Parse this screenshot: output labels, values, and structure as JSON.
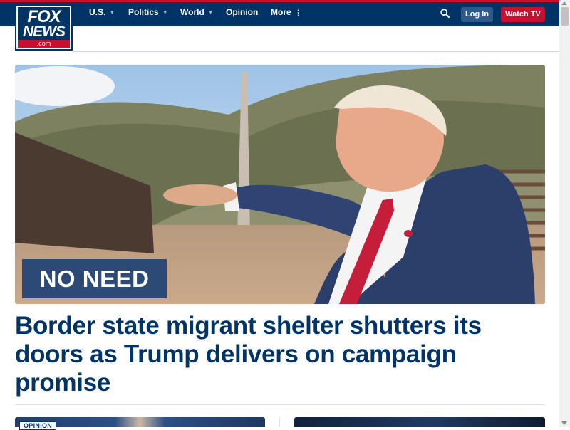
{
  "header": {
    "logo": {
      "line1": "FOX",
      "line2": "NEWS",
      "suffix": ".com"
    },
    "nav": [
      {
        "label": "U.S.",
        "has_dropdown": true
      },
      {
        "label": "Politics",
        "has_dropdown": true
      },
      {
        "label": "World",
        "has_dropdown": true
      },
      {
        "label": "Opinion",
        "has_dropdown": false
      },
      {
        "label": "More",
        "has_dropdown": true
      }
    ],
    "search_icon": "search-icon",
    "login_label": "Log In",
    "watch_label": "Watch TV"
  },
  "hero": {
    "kicker": "NO NEED",
    "headline": "Border state migrant shelter shutters its doors as Trump delivers on campaign promise"
  },
  "cards": [
    {
      "badge": "OPINION"
    },
    {}
  ],
  "colors": {
    "brand_navy": "#003366",
    "accent_red": "#c8102e",
    "login_button": "#2d5a8a",
    "kicker_bg": "#2c4a75",
    "headline": "#003366"
  }
}
